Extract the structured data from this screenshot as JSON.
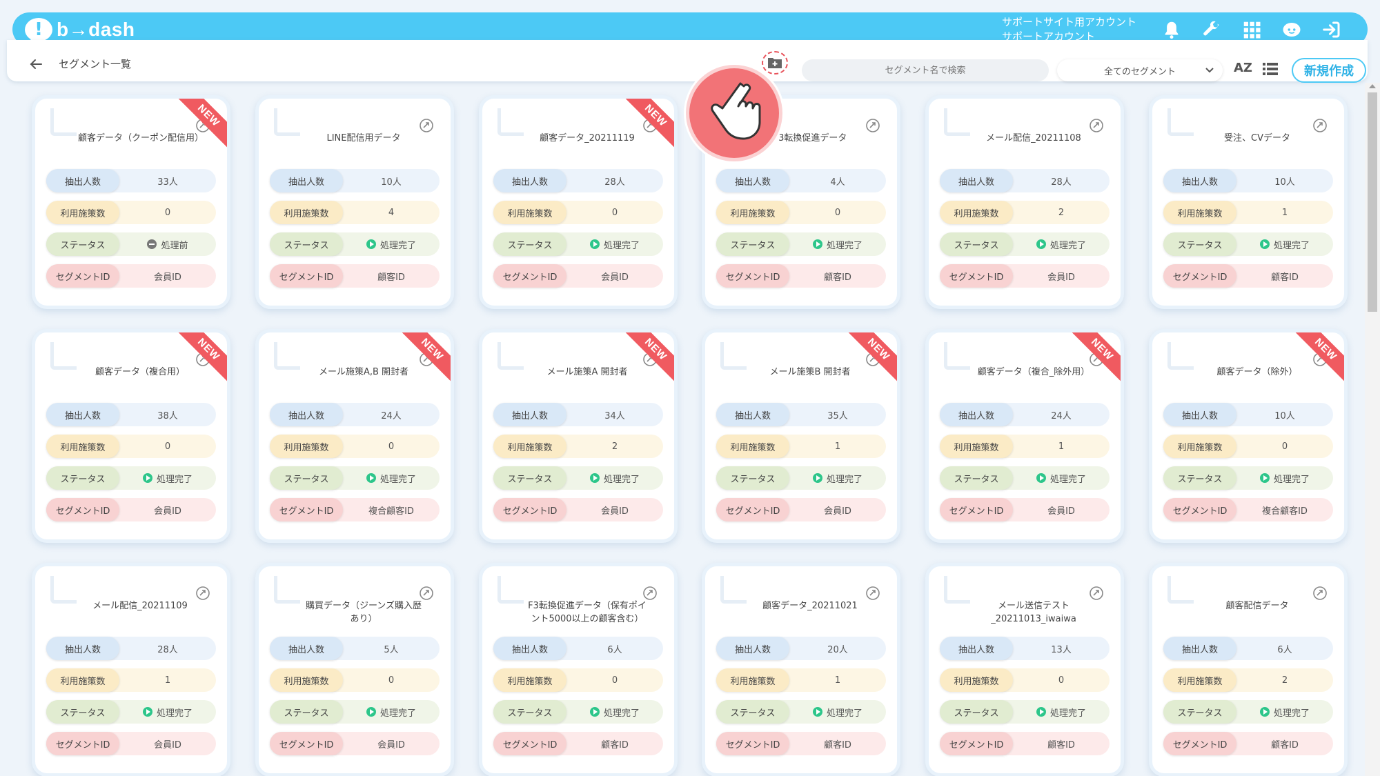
{
  "app": {
    "logo_text": "b→dash"
  },
  "header": {
    "account_line1": "サポートサイト用アカウント",
    "account_line2": "サポートアカウント"
  },
  "toolbar": {
    "breadcrumb": "セグメント一覧",
    "search_placeholder": "セグメント名で検索",
    "filter_selected": "全てのセグメント",
    "sort_label": "AZ",
    "new_button": "新規作成"
  },
  "labels": {
    "count": "抽出人数",
    "usage": "利用施策数",
    "status": "ステータス",
    "segment_id": "セグメントID",
    "new_badge": "NEW"
  },
  "cards": [
    {
      "title": "顧客データ（クーポン配信用）",
      "count": "33人",
      "usage": "0",
      "status": "処理前",
      "status_type": "pending",
      "segment_id": "会員ID",
      "new": true
    },
    {
      "title": "LINE配信用データ",
      "count": "10人",
      "usage": "4",
      "status": "処理完了",
      "status_type": "done",
      "segment_id": "顧客ID",
      "new": false
    },
    {
      "title": "顧客データ_20211119",
      "count": "28人",
      "usage": "0",
      "status": "処理完了",
      "status_type": "done",
      "segment_id": "会員ID",
      "new": true
    },
    {
      "title": "F3転換促進データ",
      "count": "4人",
      "usage": "0",
      "status": "処理完了",
      "status_type": "done",
      "segment_id": "顧客ID",
      "new": false
    },
    {
      "title": "メール配信_20211108",
      "count": "28人",
      "usage": "2",
      "status": "処理完了",
      "status_type": "done",
      "segment_id": "会員ID",
      "new": false
    },
    {
      "title": "受注、CVデータ",
      "count": "10人",
      "usage": "1",
      "status": "処理完了",
      "status_type": "done",
      "segment_id": "顧客ID",
      "new": false
    },
    {
      "title": "顧客データ（複合用）",
      "count": "38人",
      "usage": "0",
      "status": "処理完了",
      "status_type": "done",
      "segment_id": "会員ID",
      "new": true
    },
    {
      "title": "メール施策A,B 開封者",
      "count": "24人",
      "usage": "0",
      "status": "処理完了",
      "status_type": "done",
      "segment_id": "複合顧客ID",
      "new": true
    },
    {
      "title": "メール施策A 開封者",
      "count": "34人",
      "usage": "2",
      "status": "処理完了",
      "status_type": "done",
      "segment_id": "会員ID",
      "new": true
    },
    {
      "title": "メール施策B 開封者",
      "count": "35人",
      "usage": "1",
      "status": "処理完了",
      "status_type": "done",
      "segment_id": "会員ID",
      "new": true
    },
    {
      "title": "顧客データ（複合_除外用）",
      "count": "24人",
      "usage": "1",
      "status": "処理完了",
      "status_type": "done",
      "segment_id": "会員ID",
      "new": true
    },
    {
      "title": "顧客データ（除外）",
      "count": "10人",
      "usage": "0",
      "status": "処理完了",
      "status_type": "done",
      "segment_id": "複合顧客ID",
      "new": true
    },
    {
      "title": "メール配信_20211109",
      "count": "28人",
      "usage": "1",
      "status": "処理完了",
      "status_type": "done",
      "segment_id": "会員ID",
      "new": false
    },
    {
      "title": "購買データ（ジーンズ購入歴あり）",
      "count": "5人",
      "usage": "0",
      "status": "処理完了",
      "status_type": "done",
      "segment_id": "会員ID",
      "new": false
    },
    {
      "title": "F3転換促進データ（保有ポイント5000以上の顧客含む）",
      "count": "6人",
      "usage": "0",
      "status": "処理完了",
      "status_type": "done",
      "segment_id": "顧客ID",
      "new": false
    },
    {
      "title": "顧客データ_20211021",
      "count": "20人",
      "usage": "1",
      "status": "処理完了",
      "status_type": "done",
      "segment_id": "顧客ID",
      "new": false
    },
    {
      "title": "メール送信テスト_20211013_iwaiwa",
      "count": "13人",
      "usage": "0",
      "status": "処理完了",
      "status_type": "done",
      "segment_id": "顧客ID",
      "new": false
    },
    {
      "title": "顧客配信データ",
      "count": "6人",
      "usage": "2",
      "status": "処理完了",
      "status_type": "done",
      "segment_id": "顧客ID",
      "new": false
    }
  ]
}
